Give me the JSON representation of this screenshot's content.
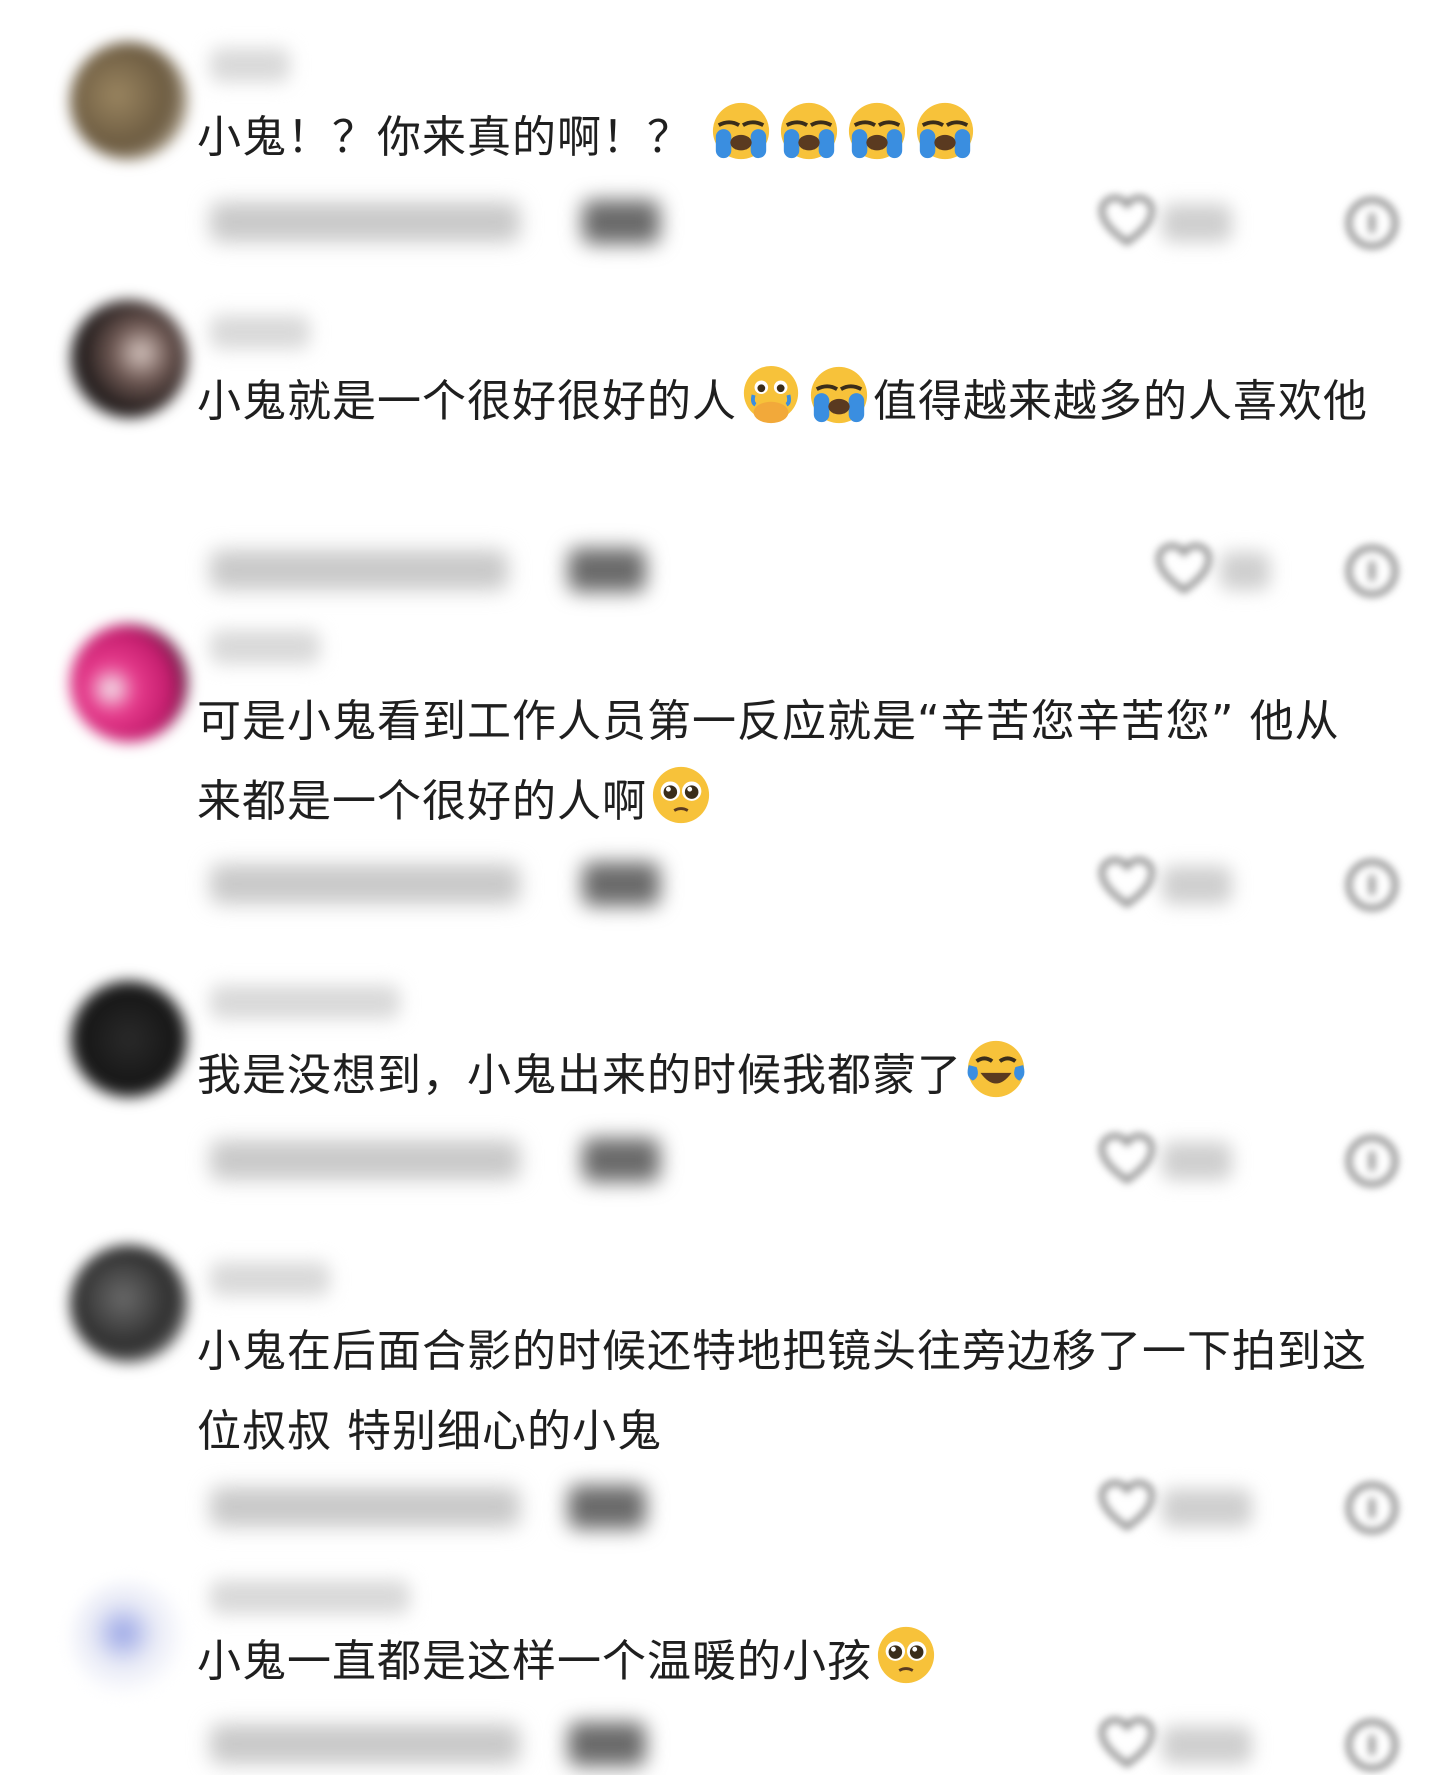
{
  "comments": [
    {
      "text": "小鬼！？你来真的啊！？",
      "emojis": [
        "loudly-crying",
        "loudly-crying",
        "loudly-crying",
        "loudly-crying"
      ]
    },
    {
      "text_a": "小鬼就是一个很好很好的人",
      "emojis_mid": [
        "teary-hand-over-mouth",
        "loudly-crying"
      ],
      "text_b": "值得越来越多的人喜欢他"
    },
    {
      "text": "可是小鬼看到工作人员第一反应就是“辛苦您辛苦您” 他从来都是一个很好的人啊",
      "emojis": [
        "pleading-face"
      ]
    },
    {
      "text": "我是没想到，小鬼出来的时候我都蒙了",
      "emojis": [
        "tears-of-joy"
      ]
    },
    {
      "text": "小鬼在后面合影的时候还特地把镜头往旁边移了一下拍到这位叔叔 特别细心的小鬼",
      "emojis": []
    },
    {
      "text": "小鬼一直都是这样一个温暖的小孩",
      "emojis": [
        "pleading-face"
      ]
    }
  ],
  "icons": {
    "like": "heart-icon",
    "dislike": "thumbs-down-icon"
  },
  "colors": {
    "text": "#1f1f1f",
    "emoji_yellow": "#f7c23a",
    "emoji_tear": "#3a8ee0"
  }
}
